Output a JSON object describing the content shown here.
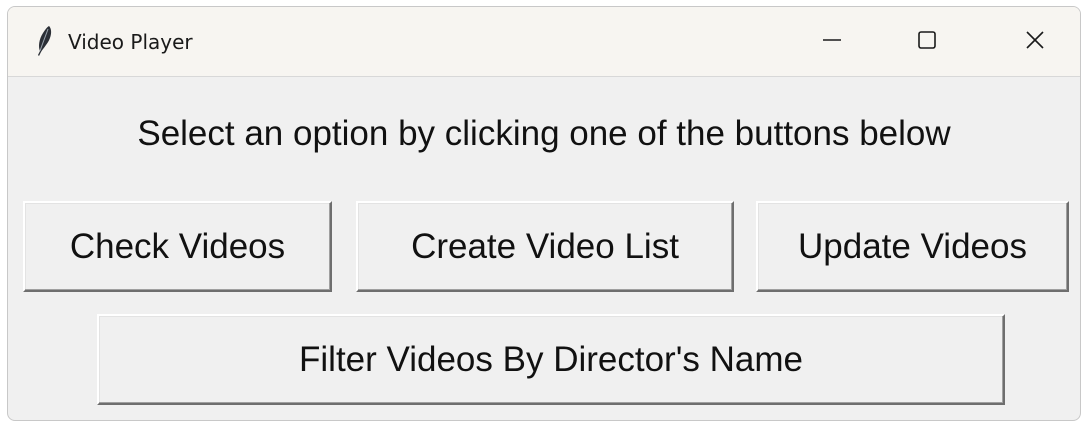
{
  "window": {
    "title": "Video Player",
    "app_icon": "feather-icon",
    "controls": {
      "minimize_icon": "minimize-icon",
      "maximize_icon": "maximize-icon",
      "close_icon": "close-icon"
    }
  },
  "main": {
    "prompt": "Select an option by clicking one of the buttons below",
    "buttons": {
      "check": "Check Videos",
      "create": "Create Video List",
      "update": "Update Videos",
      "filter": "Filter Videos By Director's Name"
    }
  },
  "colors": {
    "window_bg": "#f0f0f0",
    "titlebar_bg": "#f7f5f1",
    "text": "#111111"
  }
}
